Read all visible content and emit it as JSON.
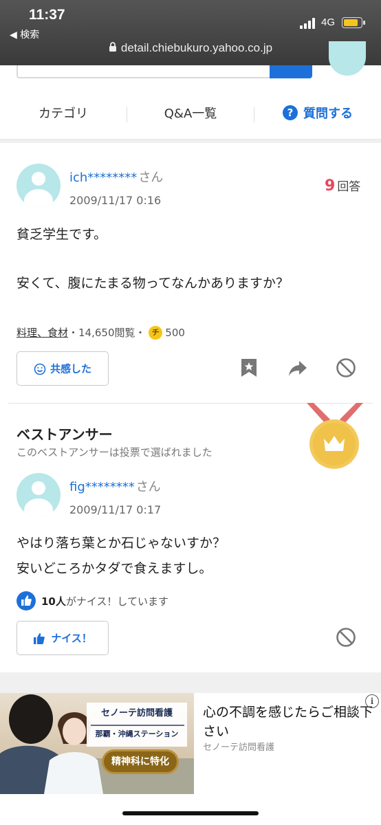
{
  "status": {
    "time": "11:37",
    "back_label": "◀ 検索",
    "network": "4G"
  },
  "browser": {
    "url": "detail.chiebukuro.yahoo.co.jp"
  },
  "colors": {
    "accent": "#1d70d9",
    "answer_count": "#e5475f",
    "avatar": "#b7e7e8",
    "coin": "#f5c518",
    "medal": "#f3c95a",
    "ribbon": "#e06e6e"
  },
  "nav": {
    "categories": "カテゴリ",
    "qa_list": "Q&A一覧",
    "ask": "質問する",
    "ask_icon": "?"
  },
  "question": {
    "user": "ich********",
    "honorific": "さん",
    "date": "2009/11/17 0:16",
    "answer_count": "9",
    "answer_label": "回答",
    "body_line1": "貧乏学生です。",
    "body_line2": "安くて、腹にたまる物ってなんかありますか？",
    "category": "料理、食材",
    "views": "・14,650閲覧・",
    "coin_glyph": "チ",
    "coins": "500",
    "empathy_button": "共感した",
    "icons": [
      "smile-icon",
      "bookmark-star-icon",
      "share-arrow-icon",
      "block-icon"
    ]
  },
  "best_answer": {
    "title": "ベストアンサー",
    "subtitle": "このベストアンサーは投票で選ばれました",
    "user": "fig********",
    "honorific": "さん",
    "date": "2009/11/17 0:17",
    "body_line1": "やはり落ち葉とか石じゃないすか？",
    "body_line2": "安いどころかタダで食えますし。",
    "likes_count": "10人",
    "likes_text": "がナイス！しています",
    "nice_button": "ナイス！",
    "icons": [
      "crown-medal-icon",
      "thumbs-up-icon",
      "block-icon"
    ]
  },
  "ad": {
    "brand_line1": "セノーテ訪問看護",
    "brand_line2": "那覇・沖縄ステーション",
    "badge": "精神科に特化",
    "title": "心の不調を感じたらご相談下さい",
    "sponsor": "セノーテ訪問看護",
    "info_glyph": "i"
  }
}
